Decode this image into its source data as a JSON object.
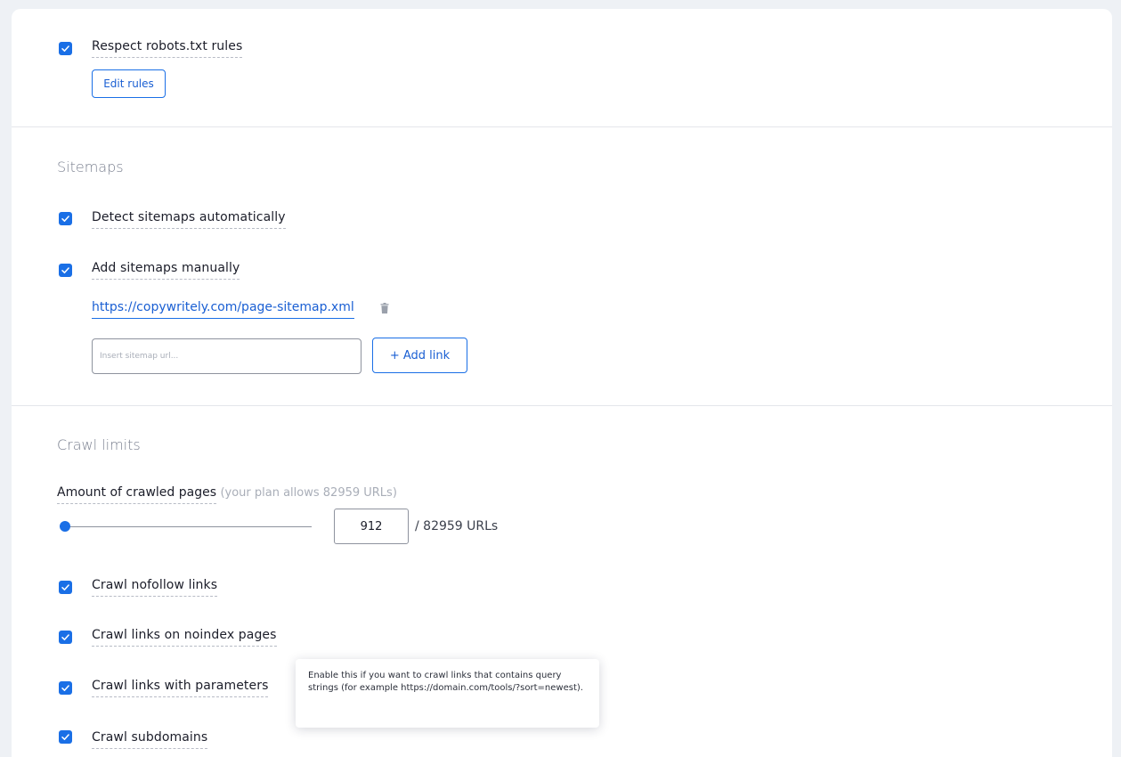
{
  "robots": {
    "checkbox_label": "Respect robots.txt rules",
    "checked": true,
    "edit_button": "Edit rules"
  },
  "sitemaps": {
    "title": "Sitemaps",
    "detect_label": "Detect sitemaps automatically",
    "detect_checked": true,
    "manual_label": "Add sitemaps manually",
    "manual_checked": true,
    "links": [
      "https://copywritely.com/page-sitemap.xml"
    ],
    "input_placeholder": "Insert sitemap url...",
    "add_button": "+ Add link"
  },
  "crawl_limits": {
    "title": "Crawl limits",
    "amount_label": "Amount of crawled pages",
    "amount_note": "(your plan allows 82959 URLs)",
    "slider_value_fraction": 0.011,
    "pages_value": "912",
    "pages_total": "/ 82959 URLs",
    "options": [
      {
        "label": "Crawl nofollow links",
        "checked": true
      },
      {
        "label": "Crawl links on noindex pages",
        "checked": true
      },
      {
        "label": "Crawl links with parameters",
        "checked": true
      },
      {
        "label": "Crawl subdomains",
        "checked": true
      }
    ]
  },
  "tooltip": {
    "text": "Enable this if you want to crawl links that contains query strings (for example https://domain.com/tools/?sort=newest)."
  },
  "colors": {
    "accent": "#1a6fe6",
    "background": "#eef1f5",
    "muted_text": "#7b8190"
  }
}
